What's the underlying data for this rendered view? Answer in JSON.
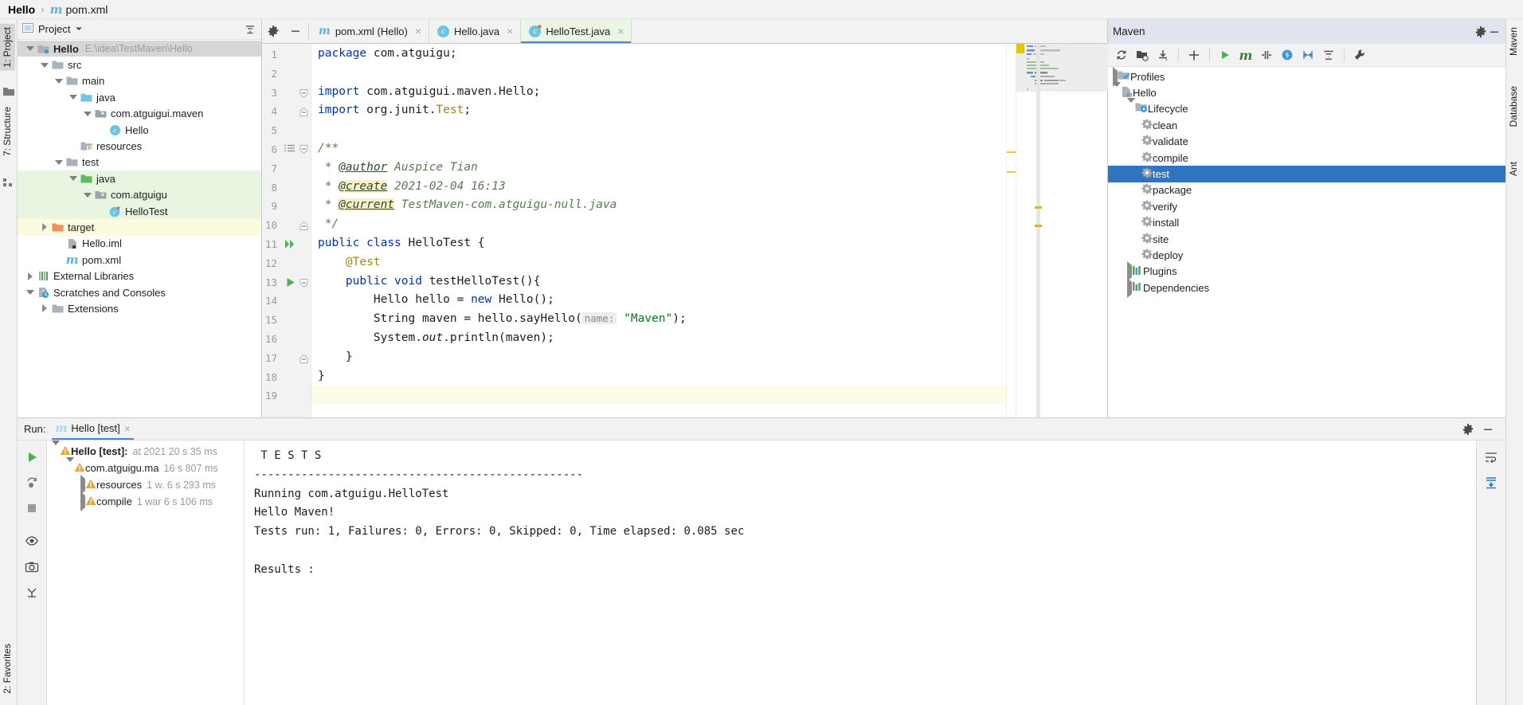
{
  "breadcrumb": {
    "project": "Hello",
    "separator": "›",
    "file": "pom.xml",
    "m_glyph": "m"
  },
  "left_strip": {
    "tabs": [
      {
        "label": "1: Project",
        "selected": true
      },
      {
        "label": "7: Structure",
        "selected": false
      }
    ],
    "bottom_tab": "2: Favorites"
  },
  "right_strip": {
    "tabs": [
      "Maven",
      "Database",
      "Ant"
    ]
  },
  "project_panel": {
    "title": "Project",
    "collapse_icon": "collapse-all-icon",
    "settings_icon": "gear-icon",
    "hide_icon": "minimize-icon",
    "tree": [
      {
        "label": "Hello",
        "path": "E:\\idea\\TestMaven\\Hello",
        "depth": 0,
        "arrow": "down",
        "icon": "module-folder-icon",
        "bold": true,
        "hl": "grey"
      },
      {
        "label": "src",
        "path": "",
        "depth": 1,
        "arrow": "down",
        "icon": "folder-icon",
        "bold": false,
        "hl": ""
      },
      {
        "label": "main",
        "path": "",
        "depth": 2,
        "arrow": "down",
        "icon": "folder-icon",
        "bold": false,
        "hl": ""
      },
      {
        "label": "java",
        "path": "",
        "depth": 3,
        "arrow": "down",
        "icon": "source-folder-icon",
        "bold": false,
        "hl": ""
      },
      {
        "label": "com.atguigui.maven",
        "path": "",
        "depth": 4,
        "arrow": "down",
        "icon": "package-icon",
        "bold": false,
        "hl": ""
      },
      {
        "label": "Hello",
        "path": "",
        "depth": 5,
        "arrow": "none",
        "icon": "java-class-icon",
        "bold": false,
        "hl": ""
      },
      {
        "label": "resources",
        "path": "",
        "depth": 3,
        "arrow": "none",
        "icon": "resources-folder-icon",
        "bold": false,
        "hl": ""
      },
      {
        "label": "test",
        "path": "",
        "depth": 2,
        "arrow": "down",
        "icon": "folder-icon",
        "bold": false,
        "hl": ""
      },
      {
        "label": "java",
        "path": "",
        "depth": 3,
        "arrow": "down",
        "icon": "test-source-folder-icon",
        "bold": false,
        "hl": "green"
      },
      {
        "label": "com.atguigu",
        "path": "",
        "depth": 4,
        "arrow": "down",
        "icon": "package-icon",
        "bold": false,
        "hl": "green"
      },
      {
        "label": "HelloTest",
        "path": "",
        "depth": 5,
        "arrow": "none",
        "icon": "java-test-class-icon",
        "bold": false,
        "hl": "green"
      },
      {
        "label": "target",
        "path": "",
        "depth": 1,
        "arrow": "right",
        "icon": "excluded-folder-icon",
        "bold": false,
        "hl": "yellow"
      },
      {
        "label": "Hello.iml",
        "path": "",
        "depth": 2,
        "arrow": "none",
        "icon": "iml-file-icon",
        "bold": false,
        "hl": ""
      },
      {
        "label": "pom.xml",
        "path": "",
        "depth": 2,
        "arrow": "none",
        "icon": "maven-pom-icon",
        "bold": false,
        "hl": ""
      },
      {
        "label": "External Libraries",
        "path": "",
        "depth": 0,
        "arrow": "right",
        "icon": "libraries-icon",
        "bold": false,
        "hl": ""
      },
      {
        "label": "Scratches and Consoles",
        "path": "",
        "depth": 0,
        "arrow": "down",
        "icon": "scratches-icon",
        "bold": false,
        "hl": ""
      },
      {
        "label": "Extensions",
        "path": "",
        "depth": 1,
        "arrow": "right",
        "icon": "folder-icon",
        "bold": false,
        "hl": ""
      }
    ]
  },
  "editor": {
    "toolbar": {
      "settings_icon": "gear-icon",
      "hide_icon": "minimize-icon"
    },
    "tabs": [
      {
        "label": "pom.xml (Hello)",
        "icon": "maven-pom-icon",
        "active": false,
        "closable": true
      },
      {
        "label": "Hello.java",
        "icon": "java-class-icon",
        "active": false,
        "closable": true
      },
      {
        "label": "HelloTest.java",
        "icon": "java-test-class-icon",
        "active": true,
        "closable": true
      }
    ],
    "line_numbers": [
      "1",
      "2",
      "3",
      "4",
      "5",
      "6",
      "7",
      "8",
      "9",
      "10",
      "11",
      "12",
      "13",
      "14",
      "15",
      "16",
      "17",
      "18",
      "19"
    ],
    "code_lines": [
      "package com.atguigu;",
      "",
      "import com.atguigui.maven.Hello;",
      "import org.junit.Test;",
      "",
      "/**",
      " * @author Auspice Tian",
      " * @create 2021-02-04 16:13",
      " * @current TestMaven-com.atguigu-null.java",
      " */",
      "public class HelloTest {",
      "    @Test",
      "    public void testHelloTest(){",
      "        Hello hello = new Hello();",
      "        String maven = hello.sayHello( name: \"Maven\");",
      "        System.out.println(maven);",
      "    }",
      "}",
      ""
    ],
    "param_hint": "name:",
    "string_literal": "\"Maven\"",
    "gutter_icons": {
      "line6": "format-block-icon",
      "line11": "run-all-tests-icon",
      "line13": "run-test-icon"
    }
  },
  "maven_panel": {
    "title": "Maven",
    "settings_icon": "gear-icon",
    "hide_icon": "minimize-icon",
    "toolbar_icons": [
      "reload-all-projects-icon",
      "generate-sources-icon",
      "download-sources-icon",
      "add-maven-project-icon",
      "run-maven-build-icon",
      "execute-maven-goal-icon",
      "toggle-skip-tests-icon",
      "toggle-offline-mode-icon",
      "show-dependencies-icon",
      "collapse-all-icon",
      "maven-settings-icon"
    ],
    "tree": [
      {
        "label": "Profiles",
        "depth": 0,
        "arrow": "right",
        "icon": "profiles-icon",
        "selected": false
      },
      {
        "label": "Hello",
        "depth": 0,
        "arrow": "down",
        "icon": "maven-project-icon",
        "selected": false
      },
      {
        "label": "Lifecycle",
        "depth": 1,
        "arrow": "down",
        "icon": "lifecycle-folder-icon",
        "selected": false
      },
      {
        "label": "clean",
        "depth": 2,
        "arrow": "none",
        "icon": "maven-goal-icon",
        "selected": false
      },
      {
        "label": "validate",
        "depth": 2,
        "arrow": "none",
        "icon": "maven-goal-icon",
        "selected": false
      },
      {
        "label": "compile",
        "depth": 2,
        "arrow": "none",
        "icon": "maven-goal-icon",
        "selected": false
      },
      {
        "label": "test",
        "depth": 2,
        "arrow": "none",
        "icon": "maven-goal-icon",
        "selected": true
      },
      {
        "label": "package",
        "depth": 2,
        "arrow": "none",
        "icon": "maven-goal-icon",
        "selected": false
      },
      {
        "label": "verify",
        "depth": 2,
        "arrow": "none",
        "icon": "maven-goal-icon",
        "selected": false
      },
      {
        "label": "install",
        "depth": 2,
        "arrow": "none",
        "icon": "maven-goal-icon",
        "selected": false
      },
      {
        "label": "site",
        "depth": 2,
        "arrow": "none",
        "icon": "maven-goal-icon",
        "selected": false
      },
      {
        "label": "deploy",
        "depth": 2,
        "arrow": "none",
        "icon": "maven-goal-icon",
        "selected": false
      },
      {
        "label": "Plugins",
        "depth": 1,
        "arrow": "right",
        "icon": "plugins-icon",
        "selected": false
      },
      {
        "label": "Dependencies",
        "depth": 1,
        "arrow": "right",
        "icon": "dependencies-icon",
        "selected": false
      }
    ]
  },
  "run_panel": {
    "label": "Run:",
    "tab_label": "Hello [test]",
    "tab_icon": "maven-pom-icon",
    "tab_close": "×",
    "settings_icon": "gear-icon",
    "hide_icon": "minimize-icon",
    "toolbar_icons": [
      "rerun-icon",
      "rerun-failed-icon",
      "stop-icon",
      "toggle-auto-test-icon",
      "screenshot-icon",
      "pin-icon"
    ],
    "right_icons": [
      "wrap-text-icon",
      "scroll-to-end-icon"
    ],
    "tree": [
      {
        "label": "Hello [test]:",
        "detail": "at 2021 20 s 35 ms",
        "depth": 0,
        "arrow": "down",
        "bold": true
      },
      {
        "label": "com.atguigu.ma",
        "detail": "16 s 807 ms",
        "depth": 1,
        "arrow": "down",
        "bold": false
      },
      {
        "label": "resources",
        "detail": "1 w. 6 s 293 ms",
        "depth": 2,
        "arrow": "right",
        "bold": false
      },
      {
        "label": "compile",
        "detail": "1 war 6 s 106 ms",
        "depth": 2,
        "arrow": "right",
        "bold": false
      }
    ],
    "console_lines": [
      " T E S T S",
      "-------------------------------------------------",
      "Running com.atguigu.HelloTest",
      "Hello Maven!",
      "Tests run: 1, Failures: 0, Errors: 0, Skipped: 0, Time elapsed: 0.085 sec",
      "",
      "Results :"
    ]
  },
  "colors": {
    "accent_blue": "#2f74c0",
    "tab_active_green": "#eaf5e6",
    "tree_highlight_green": "#e7f5e1",
    "tree_highlight_yellow": "#fbfbe0",
    "selection_grey": "#d6d6d6",
    "maven_header": "#dfe4ed",
    "keyword": "#0033b3",
    "string": "#067d17",
    "annotation": "#9e880d",
    "javadoc": "#5a7a52",
    "warning_amber": "#e8a33d"
  }
}
